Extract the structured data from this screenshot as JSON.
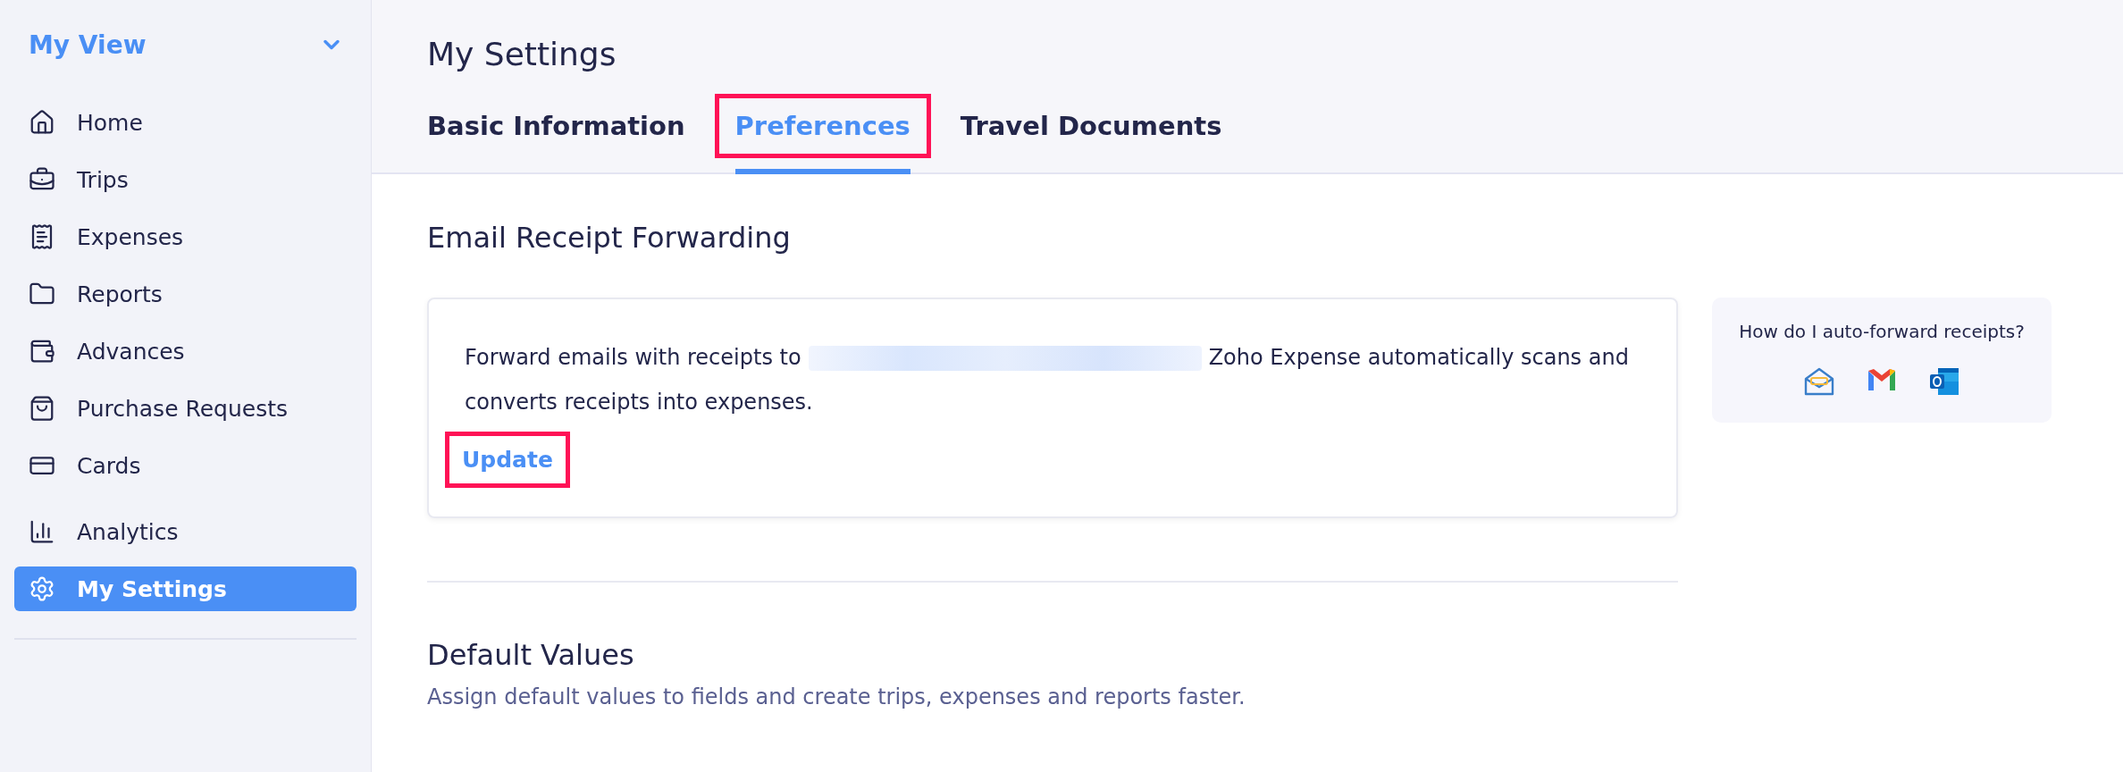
{
  "sidebar": {
    "title": "My View",
    "expanded": true,
    "items": [
      {
        "label": "Home",
        "selected": false
      },
      {
        "label": "Trips",
        "selected": false
      },
      {
        "label": "Expenses",
        "selected": false
      },
      {
        "label": "Reports",
        "selected": false
      },
      {
        "label": "Advances",
        "selected": false
      },
      {
        "label": "Purchase Requests",
        "selected": false
      },
      {
        "label": "Cards",
        "selected": false
      },
      {
        "label": "Analytics",
        "selected": false
      },
      {
        "label": "My Settings",
        "selected": true
      }
    ]
  },
  "page": {
    "title": "My Settings",
    "tabs": [
      {
        "label": "Basic Information",
        "selected": false,
        "highlighted": false
      },
      {
        "label": "Preferences",
        "selected": true,
        "highlighted": true
      },
      {
        "label": "Travel Documents",
        "selected": false,
        "highlighted": false
      }
    ]
  },
  "email_forwarding": {
    "heading": "Email Receipt Forwarding",
    "text_before": "Forward emails with receipts to",
    "text_after": "Zoho Expense automatically scans and converts receipts into expenses.",
    "update_link": {
      "label": "Update",
      "highlighted": true
    },
    "help": {
      "title": "How do I auto-forward receipts?"
    }
  },
  "default_values": {
    "heading": "Default Values",
    "description": "Assign default values to fields and create trips, expenses and reports faster."
  }
}
